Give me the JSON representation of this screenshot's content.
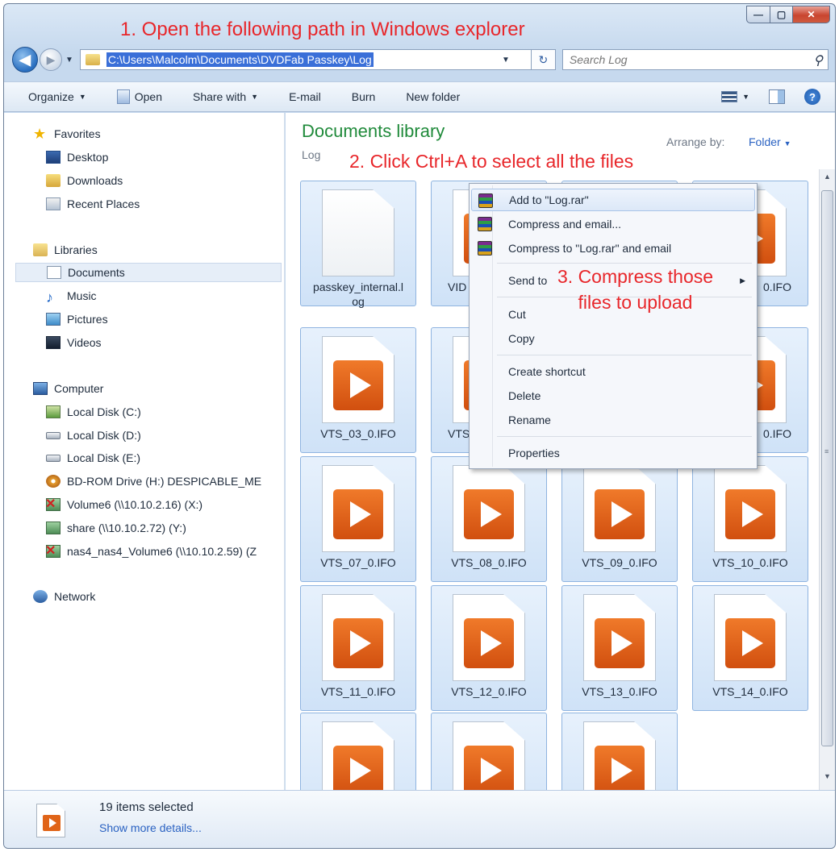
{
  "annotations": {
    "step1": "1. Open the following path in Windows explorer",
    "step2": "2. Click Ctrl+A to select all the files",
    "step3_line1": "3. Compress those",
    "step3_line2": "files to upload"
  },
  "address": {
    "path": "C:\\Users\\Malcolm\\Documents\\DVDFab Passkey\\Log",
    "search_placeholder": "Search Log"
  },
  "toolbar": {
    "organize": "Organize",
    "open": "Open",
    "share_with": "Share with",
    "email": "E-mail",
    "burn": "Burn",
    "new_folder": "New folder"
  },
  "nav": {
    "favorites": "Favorites",
    "desktop": "Desktop",
    "downloads": "Downloads",
    "recent_places": "Recent Places",
    "libraries": "Libraries",
    "documents": "Documents",
    "music": "Music",
    "pictures": "Pictures",
    "videos": "Videos",
    "computer": "Computer",
    "disk_c": "Local Disk (C:)",
    "disk_d": "Local Disk (D:)",
    "disk_e": "Local Disk (E:)",
    "bd_rom": "BD-ROM Drive (H:) DESPICABLE_ME",
    "volume6": "Volume6 (\\\\10.10.2.16) (X:)",
    "share": "share (\\\\10.10.2.72) (Y:)",
    "nas4": "nas4_nas4_Volume6 (\\\\10.10.2.59) (Z",
    "network": "Network"
  },
  "content": {
    "library_title": "Documents library",
    "library_sub": "Log",
    "arrange_label": "Arrange by:",
    "arrange_value": "Folder"
  },
  "files": {
    "f01a": "passkey_internal.l",
    "f01b": "og",
    "f02": "VID",
    "f04": "0.IFO",
    "f05": "VTS_03_0.IFO",
    "f06": "VTS",
    "f08": "0.IFO",
    "f09": "VTS_07_0.IFO",
    "f10": "VTS_08_0.IFO",
    "f11": "VTS_09_0.IFO",
    "f12": "VTS_10_0.IFO",
    "f13": "VTS_11_0.IFO",
    "f14": "VTS_12_0.IFO",
    "f15": "VTS_13_0.IFO",
    "f16": "VTS_14_0.IFO"
  },
  "context_menu": {
    "add_to_rar": "Add to \"Log.rar\"",
    "compress_email": "Compress and email...",
    "compress_to_rar_email": "Compress to \"Log.rar\" and email",
    "send_to": "Send to",
    "cut": "Cut",
    "copy": "Copy",
    "create_shortcut": "Create shortcut",
    "delete": "Delete",
    "rename": "Rename",
    "properties": "Properties"
  },
  "details": {
    "count": "19 items selected",
    "more": "Show more details..."
  }
}
